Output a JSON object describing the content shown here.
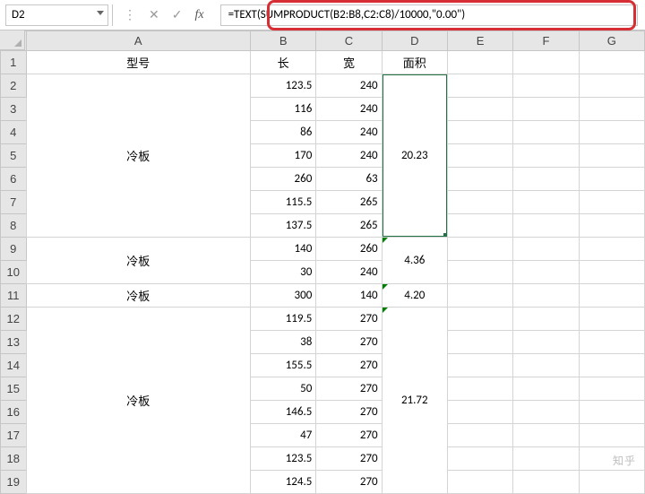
{
  "formula_bar": {
    "cell_ref": "D2",
    "fx_label": "fx",
    "formula": "=TEXT(SUMPRODUCT(B2:B8,C2:C8)/10000,\"0.00\")"
  },
  "columns": [
    "A",
    "B",
    "C",
    "D",
    "E",
    "F",
    "G"
  ],
  "selected_column": "D",
  "selected_rows": [
    2,
    3,
    4,
    5,
    6,
    7,
    8
  ],
  "headers": {
    "A": "型号",
    "B": "长",
    "C": "宽",
    "D": "面积"
  },
  "rows": [
    {
      "n": 1
    },
    {
      "n": 2,
      "B": "123.5",
      "C": "240"
    },
    {
      "n": 3,
      "B": "116",
      "C": "240"
    },
    {
      "n": 4,
      "B": "86",
      "C": "240"
    },
    {
      "n": 5,
      "B": "170",
      "C": "240"
    },
    {
      "n": 6,
      "B": "260",
      "C": "63"
    },
    {
      "n": 7,
      "B": "115.5",
      "C": "265"
    },
    {
      "n": 8,
      "B": "137.5",
      "C": "265"
    },
    {
      "n": 9,
      "B": "140",
      "C": "260"
    },
    {
      "n": 10,
      "B": "30",
      "C": "240"
    },
    {
      "n": 11,
      "B": "300",
      "C": "140"
    },
    {
      "n": 12,
      "B": "119.5",
      "C": "270"
    },
    {
      "n": 13,
      "B": "38",
      "C": "270"
    },
    {
      "n": 14,
      "B": "155.5",
      "C": "270"
    },
    {
      "n": 15,
      "B": "50",
      "C": "270"
    },
    {
      "n": 16,
      "B": "146.5",
      "C": "270"
    },
    {
      "n": 17,
      "B": "47",
      "C": "270"
    },
    {
      "n": 18,
      "B": "123.5",
      "C": "270"
    },
    {
      "n": 19,
      "B": "124.5",
      "C": "270"
    }
  ],
  "merges_A": [
    {
      "start": 2,
      "span": 7,
      "label": "冷板"
    },
    {
      "start": 9,
      "span": 2,
      "label": "冷板"
    },
    {
      "start": 11,
      "span": 1,
      "label": "冷板"
    },
    {
      "start": 12,
      "span": 8,
      "label": "冷板"
    }
  ],
  "merges_D": [
    {
      "start": 2,
      "span": 7,
      "value": "20.23",
      "tri": false,
      "active": true
    },
    {
      "start": 9,
      "span": 2,
      "value": "4.36",
      "tri": true,
      "active": false
    },
    {
      "start": 11,
      "span": 1,
      "value": "4.20",
      "tri": true,
      "active": false
    },
    {
      "start": 12,
      "span": 8,
      "value": "21.72",
      "tri": true,
      "active": false
    }
  ],
  "watermark": "知乎"
}
